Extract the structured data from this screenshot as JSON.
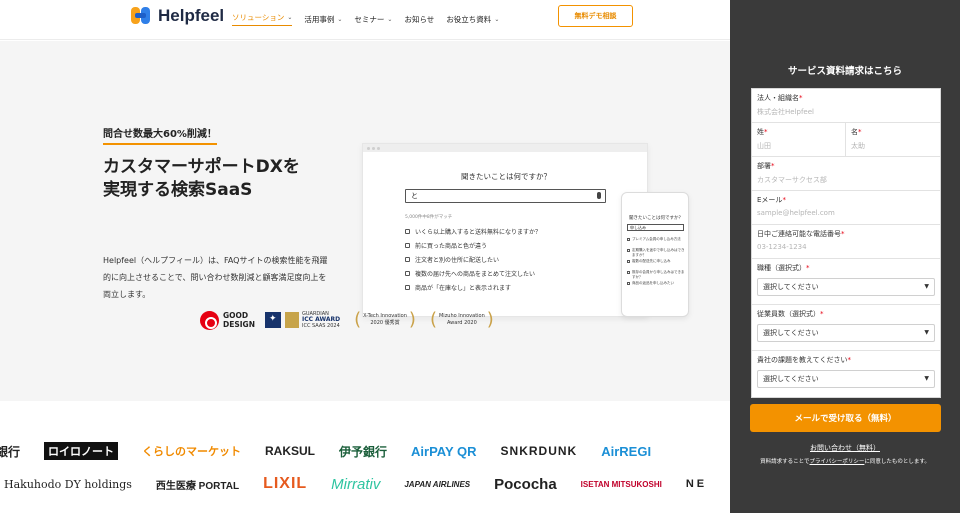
{
  "header": {
    "logo_text": "Helpfeel",
    "nav": [
      {
        "label": "ソリューション",
        "active": true,
        "has_dropdown": true
      },
      {
        "label": "活用事例",
        "active": false,
        "has_dropdown": true
      },
      {
        "label": "セミナー",
        "active": false,
        "has_dropdown": true
      },
      {
        "label": "お知らせ",
        "active": false,
        "has_dropdown": false
      },
      {
        "label": "お役立ち資料",
        "active": false,
        "has_dropdown": true
      }
    ],
    "cta_label": "無料デモ相談"
  },
  "hero": {
    "badge": "問合せ数最大60%削減！",
    "headline_line1": "カスタマーサポートDXを",
    "headline_line2": "実現する検索SaaS",
    "description": "Helpfeel（ヘルプフィール）は、FAQサイトの検索性能を飛躍的に向上させることで、問い合わせ数削減と顧客満足度向上を両立します。"
  },
  "mockup": {
    "question": "聞きたいことは何ですか？",
    "input_value": "と",
    "sub_label": "5,000件中8件がマッチ",
    "results": [
      "いくら以上購入すると送料無料になりますか？",
      "前に買った商品と色が違う",
      "注文者と別の住所に配送したい",
      "複数の届け先への商品をまとめて注文したい",
      "商品が「在庫なし」と表示されます"
    ],
    "phone_question": "聞きたいことは何ですか？",
    "phone_input": "申し込み",
    "phone_results": [
      "プレミアム会員の申し込み方法",
      "定期購入を途中で申し込みはできますか？",
      "複数の配送先に申し込み",
      "既存の会員から申し込みはできますか？",
      "商品の返品を申し込みたい"
    ]
  },
  "awards": {
    "good_design_line1": "GOOD",
    "good_design_line2": "DESIGN",
    "icc_line1": "GUARDIAN",
    "icc_line2": "ICC AWARD",
    "icc_line3": "ICC SAAS 2024",
    "xtech_line1": "X-Tech Innovation",
    "xtech_line2": "2020 優秀賞",
    "mizuho_line1": "Mizuho Innovation",
    "mizuho_line2": "Award 2020"
  },
  "client_logos": {
    "row1": [
      "銀行",
      "ロイロノート",
      "くらしのマーケット",
      "RAKSUL",
      "伊予銀行",
      "AirPAY QR",
      "SNKRDUNK",
      "AirREGI"
    ],
    "row2": [
      "Hakuhodo DY holdings",
      "西生医療 PORTAL",
      "LIXIL",
      "Mirrativ",
      "JAPAN AIRLINES",
      "Pococha",
      "ISETAN MITSUKOSHI",
      "NE"
    ]
  },
  "form": {
    "title": "サービス資料請求はこちら",
    "company_label": "法人・組織名",
    "company_placeholder": "株式会社Helpfeel",
    "last_name_label": "姓",
    "last_name_placeholder": "山田",
    "first_name_label": "名",
    "first_name_placeholder": "太助",
    "dept_label": "部署",
    "dept_placeholder": "カスタマーサクセス部",
    "email_label": "Eメール",
    "email_placeholder": "sample@helpfeel.com",
    "phone_label": "日中ご連絡可能な電話番号",
    "phone_placeholder": "03-1234-1234",
    "role_label": "職種（選択式）",
    "role_value": "選択してください",
    "size_label": "従業員数（選択式）",
    "size_value": "選択してください",
    "issue_label": "貴社の課題を教えてください",
    "issue_value": "選択してください",
    "required_mark": "*",
    "submit_label": "メールで受け取る（無料）",
    "contact_link": "お問い合わせ（無料）",
    "privacy_prefix": "資料請求することで",
    "privacy_link": "プライバシーポリシー",
    "privacy_suffix": "に同意したものとします。"
  },
  "colors": {
    "accent": "#f39200",
    "sidebar_bg": "#3a3a3a",
    "hero_bg": "#f5f5f5"
  }
}
